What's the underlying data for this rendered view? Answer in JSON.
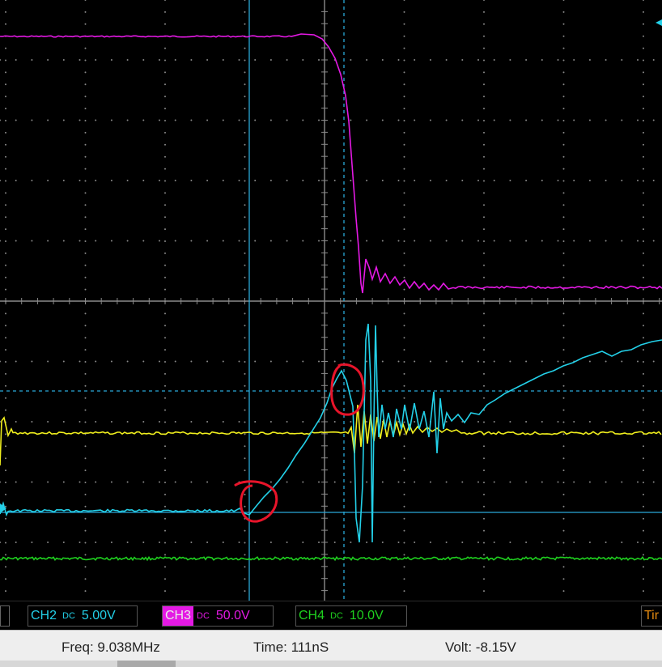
{
  "channels": {
    "ch2": {
      "label": "CH2",
      "coupling": "DC",
      "scale": "5.00V",
      "color": "#23d0e8"
    },
    "ch3": {
      "label": "CH3",
      "coupling": "DC",
      "scale": "50.0V",
      "color": "#e419e4"
    },
    "ch4": {
      "label": "CH4",
      "coupling": "DC",
      "scale": "10.0V",
      "color": "#1fd11f"
    },
    "extra": {
      "label": "Tir",
      "color": "#e48a10"
    }
  },
  "status": {
    "freq": "Freq: 9.038MHz",
    "time": "Time: 111nS",
    "volt": "Volt: -8.15V"
  },
  "colors": {
    "background": "#000000",
    "grid": "#8a8a8a",
    "ch1_trace": "#f0ef1e",
    "ch2_trace": "#23d0e8",
    "ch3_trace": "#e419e4",
    "ch4_trace": "#1fd11f",
    "cursor": "#2aa8d8",
    "annotation": "#e8142a"
  }
}
